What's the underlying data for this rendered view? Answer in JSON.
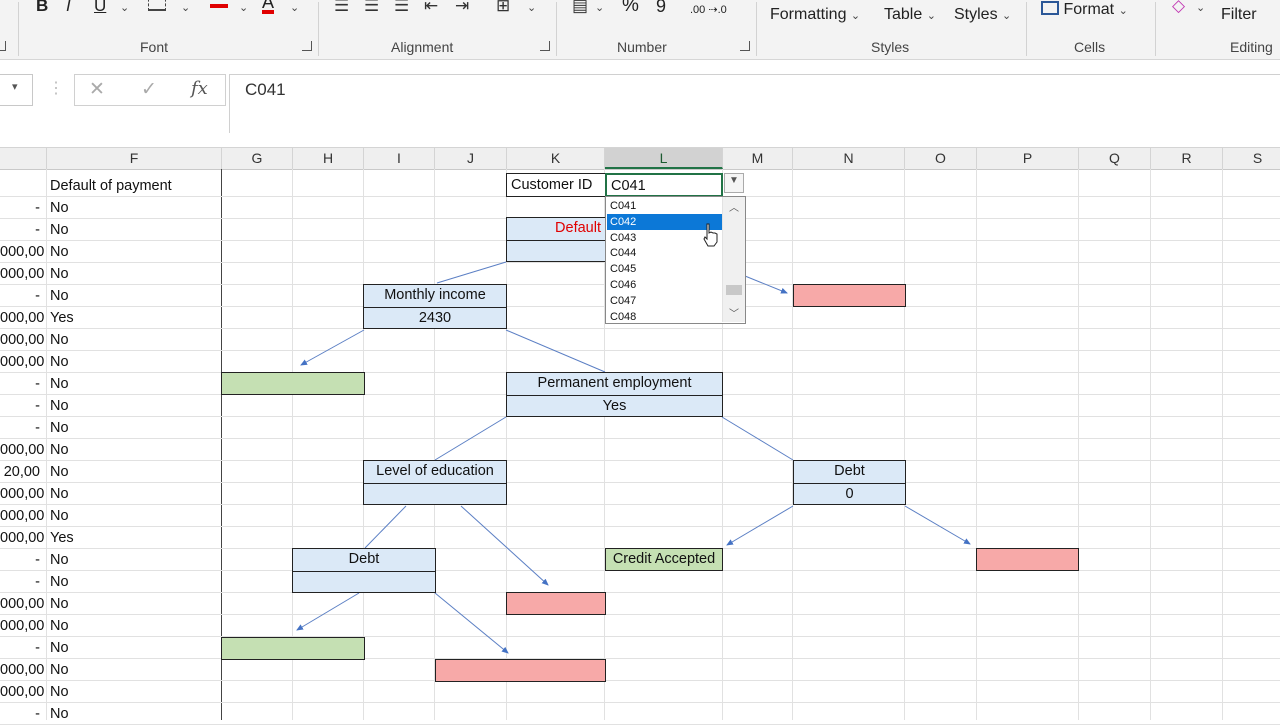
{
  "ribbon": {
    "groups": {
      "font": "Font",
      "alignment": "Alignment",
      "number": "Number",
      "styles": "Styles",
      "cells": "Cells",
      "editing": "Editing"
    },
    "buttons": {
      "bold": "B",
      "italic": "I",
      "underline": "U",
      "font_color": "A",
      "percent": "%",
      "comma": "9",
      "decimals": ".00 ⇢.0",
      "conditional_formatting": "Formatting",
      "format_as_table": "Table",
      "cell_styles": "Styles",
      "format": "Format",
      "filter": "Filter"
    }
  },
  "formula_bar": {
    "cancel": "✕",
    "enter": "✓",
    "fx": "fx",
    "value": "C041"
  },
  "columns": [
    "F",
    "G",
    "H",
    "I",
    "J",
    "K",
    "L",
    "M",
    "N",
    "O",
    "P",
    "Q",
    "R",
    "S"
  ],
  "selected_column": "L",
  "column_f_header": "Default of payment",
  "rows": [
    {
      "e": "-",
      "f": "No"
    },
    {
      "e": "-",
      "f": "No"
    },
    {
      "e": "000,00",
      "f": "No"
    },
    {
      "e": "000,00",
      "f": "No"
    },
    {
      "e": "-",
      "f": "No"
    },
    {
      "e": "000,00",
      "f": "Yes"
    },
    {
      "e": "000,00",
      "f": "No"
    },
    {
      "e": "000,00",
      "f": "No"
    },
    {
      "e": "-",
      "f": "No"
    },
    {
      "e": "-",
      "f": "No"
    },
    {
      "e": "-",
      "f": "No"
    },
    {
      "e": "000,00",
      "f": "No"
    },
    {
      "e": "20,00",
      "f": "No"
    },
    {
      "e": "000,00",
      "f": "No"
    },
    {
      "e": "000,00",
      "f": "No"
    },
    {
      "e": "000,00",
      "f": "Yes"
    },
    {
      "e": "-",
      "f": "No"
    },
    {
      "e": "-",
      "f": "No"
    },
    {
      "e": "000,00",
      "f": "No"
    },
    {
      "e": "000,00",
      "f": "No"
    },
    {
      "e": "-",
      "f": "No"
    },
    {
      "e": "000,00",
      "f": "No"
    },
    {
      "e": "000,00",
      "f": "No"
    },
    {
      "e": "-",
      "f": "No"
    }
  ],
  "customer": {
    "label": "Customer ID",
    "value": "C041"
  },
  "tree": {
    "root_label": "Default",
    "monthly_income": {
      "label": "Monthly income",
      "value": "2430"
    },
    "permanent_employment": {
      "label": "Permanent employment",
      "value": "Yes"
    },
    "level_of_education": {
      "label": "Level of education",
      "value": ""
    },
    "debt_right": {
      "label": "Debt",
      "value": "0"
    },
    "debt_left": {
      "label": "Debt",
      "value": ""
    },
    "credit_accepted": "Credit Accepted"
  },
  "dropdown": {
    "options": [
      "C041",
      "C042",
      "C043",
      "C044",
      "C045",
      "C046",
      "C047",
      "C048"
    ],
    "highlighted": "C042"
  },
  "colors": {
    "box_blue": "#dbe9f7",
    "box_green": "#c5e0b3",
    "box_red": "#f7a9a8",
    "accent_green": "#217346",
    "highlight": "#0c78d7",
    "root_text": "#e00000"
  }
}
